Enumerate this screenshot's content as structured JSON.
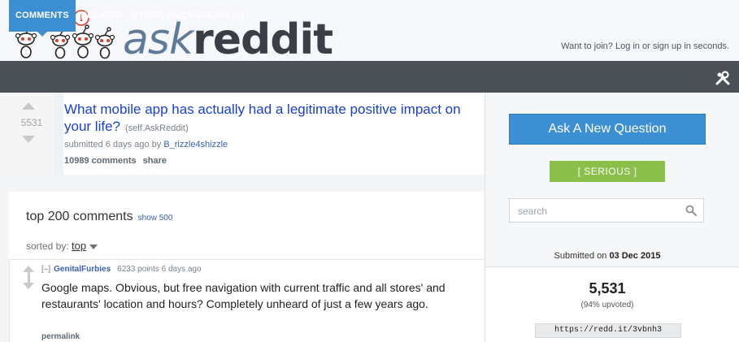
{
  "header": {
    "logo_ask": "ask",
    "logo_reddit": "reddit",
    "join_text": "Want to join? Log in or sign up in seconds."
  },
  "tabs": [
    {
      "label": "COMMENTS",
      "active": true
    },
    {
      "label": "RELATED",
      "active": false
    },
    {
      "label": "OTHER DISCUSSIONS (1)",
      "active": false
    }
  ],
  "post": {
    "score": "5531",
    "title": "What mobile app has actually had a legitimate positive impact on your life?",
    "domain": "(self.AskReddit)",
    "submitted_prefix": "submitted 6 days ago by",
    "author": "B_rizzle4shizzle",
    "comments_link": "10989 comments",
    "share_link": "share"
  },
  "comments_section": {
    "title": "top 200 comments",
    "show_more": "show 500",
    "sorted_label": "sorted by:",
    "sorted_value": "top"
  },
  "comment": {
    "collapse": "[–]",
    "author": "GenitalFurbies",
    "points": "6233 points 6 days ago",
    "body": "Google maps. Obvious, but free navigation with current traffic and all stores' and restaurants' location and hours? Completely unheard of just a few years ago.",
    "permalink": "permalink"
  },
  "sidebar": {
    "ask_button": "Ask A New Question",
    "serious_button": "[ SERIOUS ]",
    "search_placeholder": "search",
    "submitted_on_prefix": "Submitted on",
    "submitted_on_date": "03 Dec 2015",
    "points": "5,531",
    "upvoted": "(94% upvoted)",
    "shortlink": "https://redd.it/3vbnh3"
  },
  "colors": {
    "accent_blue": "#3d8fd4",
    "serious_green": "#8ac04a",
    "tabbar_dark": "#4a5055",
    "link_blue": "#1a3fd0"
  }
}
